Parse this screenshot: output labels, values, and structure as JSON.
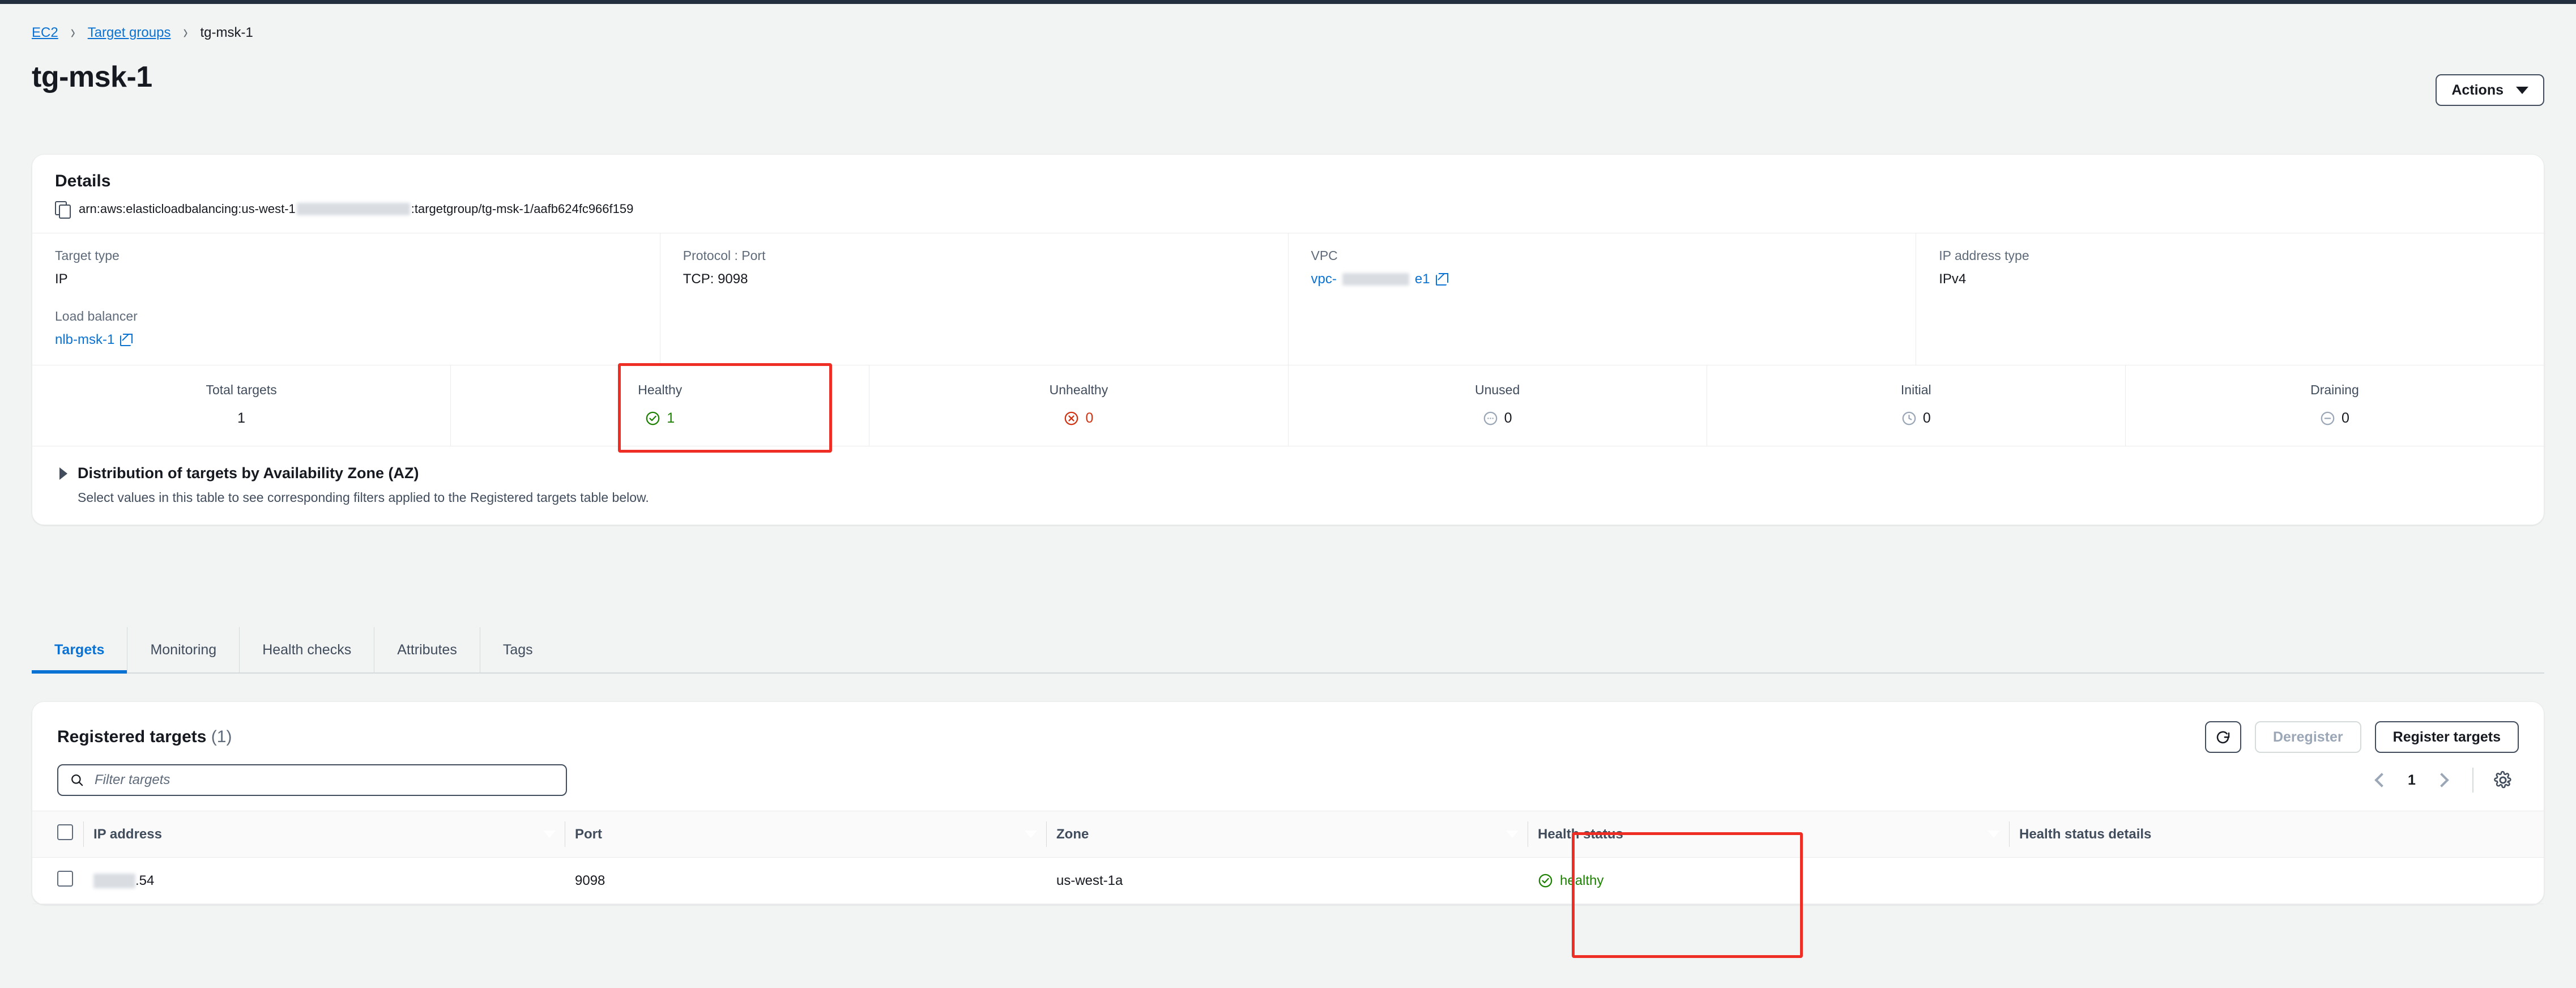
{
  "topbar": {
    "present": true
  },
  "breadcrumb": {
    "items": [
      {
        "label": "EC2",
        "link": true
      },
      {
        "label": "Target groups",
        "link": true
      },
      {
        "label": "tg-msk-1",
        "link": false
      }
    ],
    "separator": "›"
  },
  "header": {
    "title": "tg-msk-1",
    "actions_label": "Actions"
  },
  "details": {
    "title": "Details",
    "arn_prefix": "arn:aws:elasticloadbalancing:us-west-1",
    "arn_suffix": ":targetgroup/tg-msk-1/aafb624fc966f159",
    "fields": {
      "target_type_label": "Target type",
      "target_type_value": "IP",
      "protocol_port_label": "Protocol : Port",
      "protocol_port_value": "TCP: 9098",
      "vpc_label": "VPC",
      "vpc_prefix": "vpc-",
      "vpc_suffix": "e1",
      "ip_address_type_label": "IP address type",
      "ip_address_type_value": "IPv4",
      "load_balancer_label": "Load balancer",
      "load_balancer_value": "nlb-msk-1"
    }
  },
  "stats": [
    {
      "label": "Total targets",
      "value": "1",
      "icon": "none",
      "color": "#16191f"
    },
    {
      "label": "Healthy",
      "value": "1",
      "icon": "check-circle-icon",
      "color": "#1d8102",
      "highlighted": true
    },
    {
      "label": "Unhealthy",
      "value": "0",
      "icon": "x-circle-icon",
      "color": "#d13212"
    },
    {
      "label": "Unused",
      "value": "0",
      "icon": "dots-circle-icon",
      "color": "#879596"
    },
    {
      "label": "Initial",
      "value": "0",
      "icon": "clock-circle-icon",
      "color": "#879596"
    },
    {
      "label": "Draining",
      "value": "0",
      "icon": "minus-circle-icon",
      "color": "#879596"
    }
  ],
  "distribution": {
    "title": "Distribution of targets by Availability Zone (AZ)",
    "description": "Select values in this table to see corresponding filters applied to the Registered targets table below.",
    "expanded": false
  },
  "tabs": [
    {
      "label": "Targets",
      "active": true
    },
    {
      "label": "Monitoring",
      "active": false
    },
    {
      "label": "Health checks",
      "active": false
    },
    {
      "label": "Attributes",
      "active": false
    },
    {
      "label": "Tags",
      "active": false
    }
  ],
  "registered_targets": {
    "title": "Registered targets",
    "count": "(1)",
    "refresh_icon": "refresh-icon",
    "deregister_label": "Deregister",
    "deregister_disabled": true,
    "register_label": "Register targets",
    "filter_placeholder": "Filter targets",
    "filter_value": "",
    "page_number": "1",
    "settings_icon": "gear-icon",
    "columns": [
      "IP address",
      "Port",
      "Zone",
      "Health status",
      "Health status details"
    ],
    "rows": [
      {
        "ip_address_suffix": ".54",
        "port": "9098",
        "zone": "us-west-1a",
        "health_status": "healthy",
        "health_status_details": ""
      }
    ]
  },
  "annotations": {
    "healthy_stat_box_color": "#ee2e24",
    "health_status_column_box_color": "#ee2e24"
  }
}
